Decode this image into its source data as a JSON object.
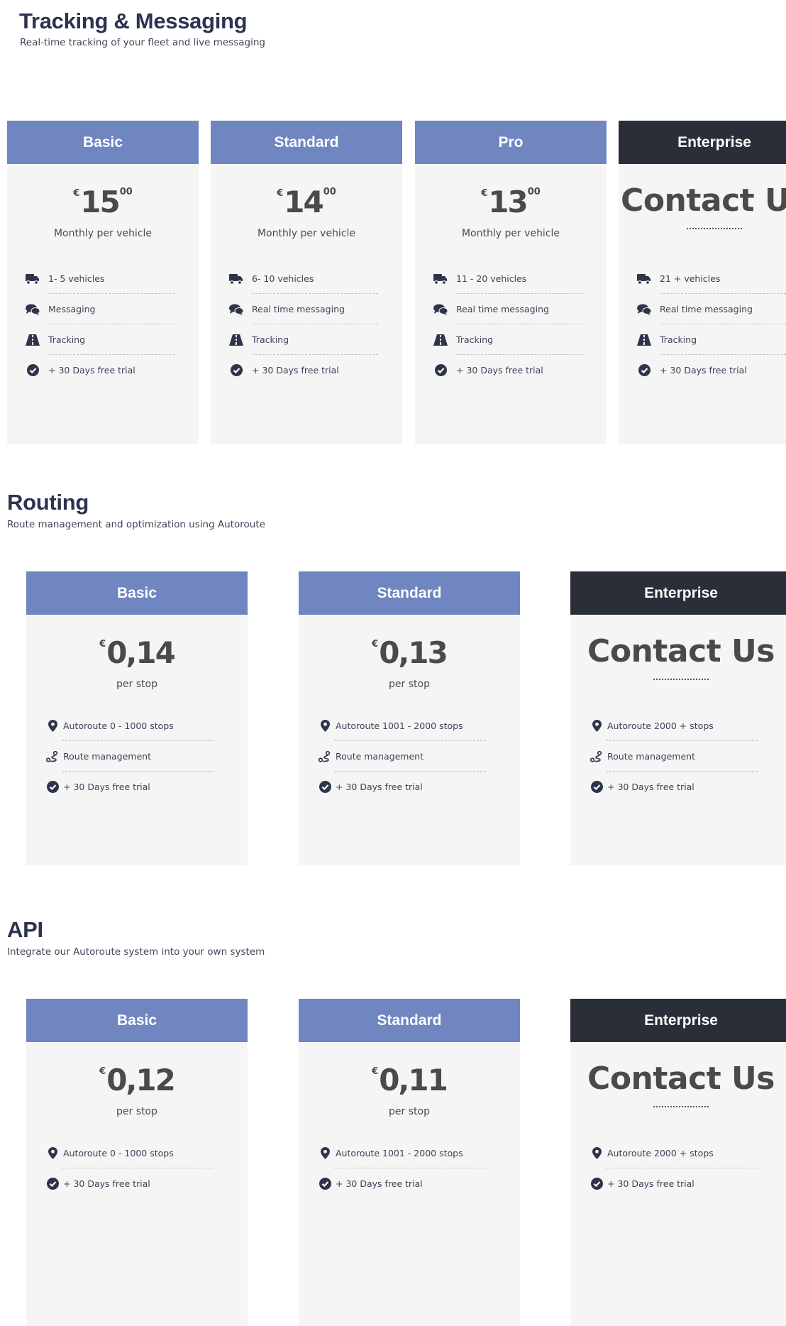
{
  "sections": [
    {
      "title": "Tracking & Messaging",
      "subtitle": "Real-time tracking of your fleet and live messaging",
      "plans": [
        {
          "name": "Basic",
          "currency": "€",
          "amount": "15",
          "cents": "00",
          "unit": "Monthly per vehicle",
          "features": [
            {
              "icon": "truck-icon",
              "text": "1- 5 vehicles"
            },
            {
              "icon": "comments-icon",
              "text": "Messaging"
            },
            {
              "icon": "road-icon",
              "text": "Tracking"
            },
            {
              "icon": "check-circle-icon",
              "text": "+ 30 Days free trial"
            }
          ]
        },
        {
          "name": "Standard",
          "currency": "€",
          "amount": "14",
          "cents": "00",
          "unit": "Monthly per vehicle",
          "features": [
            {
              "icon": "truck-icon",
              "text": "6- 10 vehicles"
            },
            {
              "icon": "comments-icon",
              "text": "Real time messaging"
            },
            {
              "icon": "road-icon",
              "text": "Tracking"
            },
            {
              "icon": "check-circle-icon",
              "text": "+ 30 Days free trial"
            }
          ]
        },
        {
          "name": "Pro",
          "currency": "€",
          "amount": "13",
          "cents": "00",
          "unit": "Monthly per vehicle",
          "features": [
            {
              "icon": "truck-icon",
              "text": "11 - 20 vehicles"
            },
            {
              "icon": "comments-icon",
              "text": "Real time messaging"
            },
            {
              "icon": "road-icon",
              "text": "Tracking"
            },
            {
              "icon": "check-circle-icon",
              "text": "+ 30 Days free trial"
            }
          ]
        },
        {
          "name": "Enterprise",
          "contact": "Contact Us",
          "features": [
            {
              "icon": "truck-icon",
              "text": "21 + vehicles"
            },
            {
              "icon": "comments-icon",
              "text": "Real time messaging"
            },
            {
              "icon": "road-icon",
              "text": "Tracking"
            },
            {
              "icon": "check-circle-icon",
              "text": "+ 30 Days free trial"
            }
          ]
        }
      ]
    },
    {
      "title": "Routing",
      "subtitle": "Route management and optimization using Autoroute",
      "plans": [
        {
          "name": "Basic",
          "currency": "€",
          "amount": "0,14",
          "unit": "per stop",
          "features": [
            {
              "icon": "map-marker-icon",
              "text": "Autoroute 0 - 1000 stops"
            },
            {
              "icon": "route-icon",
              "text": "Route management"
            },
            {
              "icon": "check-circle-icon",
              "text": "+ 30 Days free trial"
            }
          ]
        },
        {
          "name": "Standard",
          "currency": "€",
          "amount": "0,13",
          "unit": "per stop",
          "features": [
            {
              "icon": "map-marker-icon",
              "text": "Autoroute 1001 - 2000 stops"
            },
            {
              "icon": "route-icon",
              "text": "Route management"
            },
            {
              "icon": "check-circle-icon",
              "text": "+ 30 Days free trial"
            }
          ]
        },
        {
          "name": "Enterprise",
          "contact": "Contact Us",
          "features": [
            {
              "icon": "map-marker-icon",
              "text": "Autoroute 2000 + stops"
            },
            {
              "icon": "route-icon",
              "text": "Route management"
            },
            {
              "icon": "check-circle-icon",
              "text": "+ 30 Days free trial"
            }
          ]
        }
      ]
    },
    {
      "title": "API",
      "subtitle": "Integrate our Autoroute system into your own system",
      "plans": [
        {
          "name": "Basic",
          "currency": "€",
          "amount": "0,12",
          "unit": "per stop",
          "features": [
            {
              "icon": "map-marker-icon",
              "text": "Autoroute 0 - 1000 stops"
            },
            {
              "icon": "check-circle-icon",
              "text": "+ 30 Days free trial"
            }
          ]
        },
        {
          "name": "Standard",
          "currency": "€",
          "amount": "0,11",
          "unit": "per stop",
          "features": [
            {
              "icon": "map-marker-icon",
              "text": "Autoroute 1001 - 2000 stops"
            },
            {
              "icon": "check-circle-icon",
              "text": "+ 30 Days free trial"
            }
          ]
        },
        {
          "name": "Enterprise",
          "contact": "Contact Us",
          "features": [
            {
              "icon": "map-marker-icon",
              "text": "Autoroute 2000 + stops"
            },
            {
              "icon": "check-circle-icon",
              "text": "+ 30 Days free trial"
            }
          ]
        }
      ]
    }
  ],
  "colors": {
    "header_accent": "#6f86c1",
    "header_dark": "#2a2e38",
    "card_bg": "#f5f5f5",
    "title": "#2b3350",
    "icon": "#2e3449"
  }
}
